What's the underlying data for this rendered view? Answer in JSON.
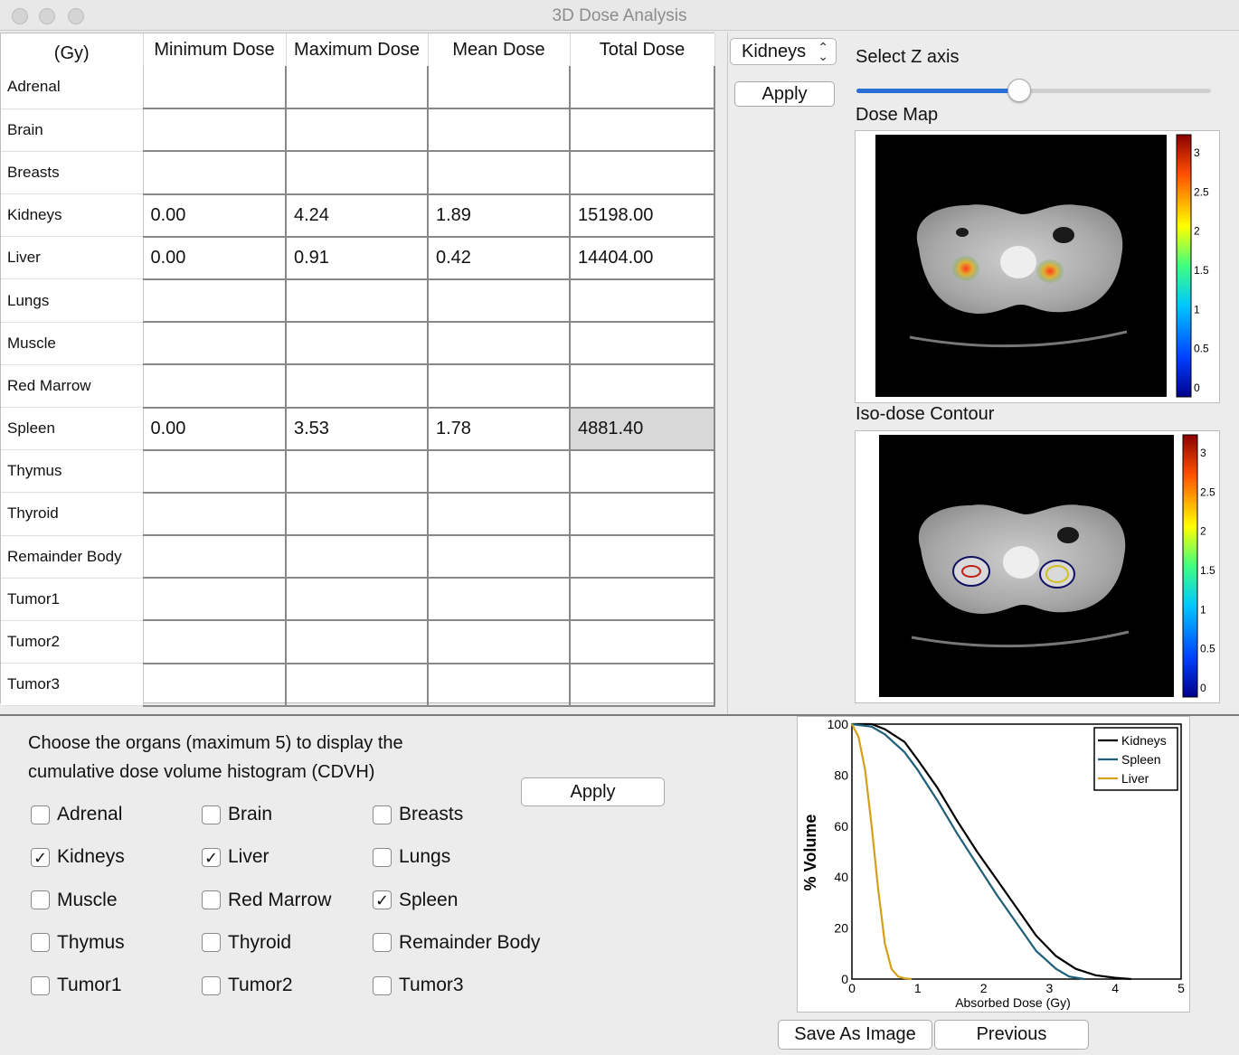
{
  "window": {
    "title": "3D Dose Analysis"
  },
  "table": {
    "corner_label": "(Gy)",
    "columns": [
      "Minimum Dose",
      "Maximum Dose",
      "Mean Dose",
      "Total Dose"
    ],
    "rows": [
      {
        "organ": "Adrenal",
        "min": "",
        "max": "",
        "mean": "",
        "total": ""
      },
      {
        "organ": "Brain",
        "min": "",
        "max": "",
        "mean": "",
        "total": ""
      },
      {
        "organ": "Breasts",
        "min": "",
        "max": "",
        "mean": "",
        "total": ""
      },
      {
        "organ": "Kidneys",
        "min": "0.00",
        "max": "4.24",
        "mean": "1.89",
        "total": "15198.00"
      },
      {
        "organ": "Liver",
        "min": "0.00",
        "max": "0.91",
        "mean": "0.42",
        "total": "14404.00"
      },
      {
        "organ": "Lungs",
        "min": "",
        "max": "",
        "mean": "",
        "total": ""
      },
      {
        "organ": "Muscle",
        "min": "",
        "max": "",
        "mean": "",
        "total": ""
      },
      {
        "organ": "Red Marrow",
        "min": "",
        "max": "",
        "mean": "",
        "total": ""
      },
      {
        "organ": "Spleen",
        "min": "0.00",
        "max": "3.53",
        "mean": "1.78",
        "total": "4881.40"
      },
      {
        "organ": "Thymus",
        "min": "",
        "max": "",
        "mean": "",
        "total": ""
      },
      {
        "organ": "Thyroid",
        "min": "",
        "max": "",
        "mean": "",
        "total": ""
      },
      {
        "organ": "Remainder Body",
        "min": "",
        "max": "",
        "mean": "",
        "total": ""
      },
      {
        "organ": "Tumor1",
        "min": "",
        "max": "",
        "mean": "",
        "total": ""
      },
      {
        "organ": "Tumor2",
        "min": "",
        "max": "",
        "mean": "",
        "total": ""
      },
      {
        "organ": "Tumor3",
        "min": "",
        "max": "",
        "mean": "",
        "total": ""
      }
    ]
  },
  "viewer": {
    "organ_select": "Kidneys",
    "apply_label": "Apply",
    "z_axis_label": "Select Z axis",
    "z_slider_fraction": 0.46,
    "dose_map_label": "Dose Map",
    "dose_map_ticks": [
      "3",
      "2.5",
      "2",
      "1.5",
      "1",
      "0.5",
      "0"
    ],
    "contour_label": "Iso-dose Contour",
    "contour_ticks": [
      "3",
      "2.5",
      "2",
      "1.5",
      "1",
      "0.5",
      "0"
    ]
  },
  "cdvh": {
    "instructions_line1": "Choose the organs (maximum 5) to display the",
    "instructions_line2": "cumulative dose volume histogram (CDVH)",
    "apply_label": "Apply",
    "checkboxes": [
      {
        "label": "Adrenal",
        "checked": false
      },
      {
        "label": "Brain",
        "checked": false
      },
      {
        "label": "Breasts",
        "checked": false
      },
      {
        "label": "Kidneys",
        "checked": true
      },
      {
        "label": "Liver",
        "checked": true
      },
      {
        "label": "Lungs",
        "checked": false
      },
      {
        "label": "Muscle",
        "checked": false
      },
      {
        "label": "Red Marrow",
        "checked": false
      },
      {
        "label": "Spleen",
        "checked": true
      },
      {
        "label": "Thymus",
        "checked": false
      },
      {
        "label": "Thyroid",
        "checked": false
      },
      {
        "label": "Remainder Body",
        "checked": false
      },
      {
        "label": "Tumor1",
        "checked": false
      },
      {
        "label": "Tumor2",
        "checked": false
      },
      {
        "label": "Tumor3",
        "checked": false
      }
    ]
  },
  "buttons": {
    "save_label": "Save As Image",
    "previous_label": "Previous"
  },
  "chart_data": {
    "type": "line",
    "title": "",
    "xlabel": "Absorbed Dose (Gy)",
    "ylabel": "% Volume",
    "xlim": [
      0,
      5
    ],
    "ylim": [
      0,
      100
    ],
    "xticks": [
      "0",
      "1",
      "2",
      "3",
      "4",
      "5"
    ],
    "yticks": [
      "0",
      "20",
      "40",
      "60",
      "80",
      "100"
    ],
    "legend_position": "top-right",
    "series": [
      {
        "name": "Kidneys",
        "color": "#000000",
        "x": [
          0,
          0.3,
          0.5,
          0.8,
          1.0,
          1.3,
          1.6,
          1.9,
          2.2,
          2.5,
          2.8,
          3.1,
          3.4,
          3.7,
          4.0,
          4.24
        ],
        "y": [
          100,
          100,
          98,
          93,
          86,
          75,
          62,
          50,
          39,
          28,
          17,
          9,
          4,
          1.5,
          0.5,
          0
        ]
      },
      {
        "name": "Spleen",
        "color": "#1f5f7a",
        "x": [
          0,
          0.3,
          0.5,
          0.8,
          1.0,
          1.3,
          1.6,
          1.9,
          2.2,
          2.5,
          2.8,
          3.1,
          3.3,
          3.53
        ],
        "y": [
          100,
          99,
          96,
          89,
          82,
          70,
          57,
          45,
          33,
          22,
          11,
          4,
          1,
          0
        ]
      },
      {
        "name": "Liver",
        "color": "#d4a017",
        "x": [
          0,
          0.1,
          0.2,
          0.3,
          0.4,
          0.5,
          0.6,
          0.7,
          0.8,
          0.91
        ],
        "y": [
          100,
          95,
          82,
          60,
          35,
          14,
          4,
          1,
          0.3,
          0
        ]
      }
    ]
  }
}
